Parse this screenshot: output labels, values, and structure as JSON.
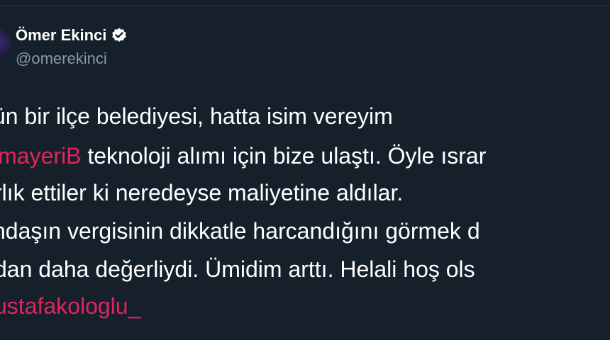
{
  "author": {
    "display_name": "Ömer Ekinci",
    "handle": "@omerekinci",
    "verified_icon": "verified-badge-icon"
  },
  "tweet": {
    "lines": [
      {
        "text": "ün bir ilçe belediyesi, hatta isim vereyim"
      },
      {
        "mention": "imayeriB",
        "text": " teknoloji alımı için bize ulaştı. Öyle ısrar"
      },
      {
        "text": "rlık ettiler ki neredeyse maliyetine aldılar."
      },
      {
        "text": "ndaşın vergisinin dikkatle harcandığını görmek d"
      },
      {
        "text": "dan daha değerliydi. Ümidim arttı. Helali hoş ols"
      },
      {
        "mention": "ustafakologlu_"
      }
    ]
  },
  "colors": {
    "background": "#15202b",
    "mention": "#e0245e",
    "handle": "#8899a6",
    "text": "#ffffff"
  }
}
